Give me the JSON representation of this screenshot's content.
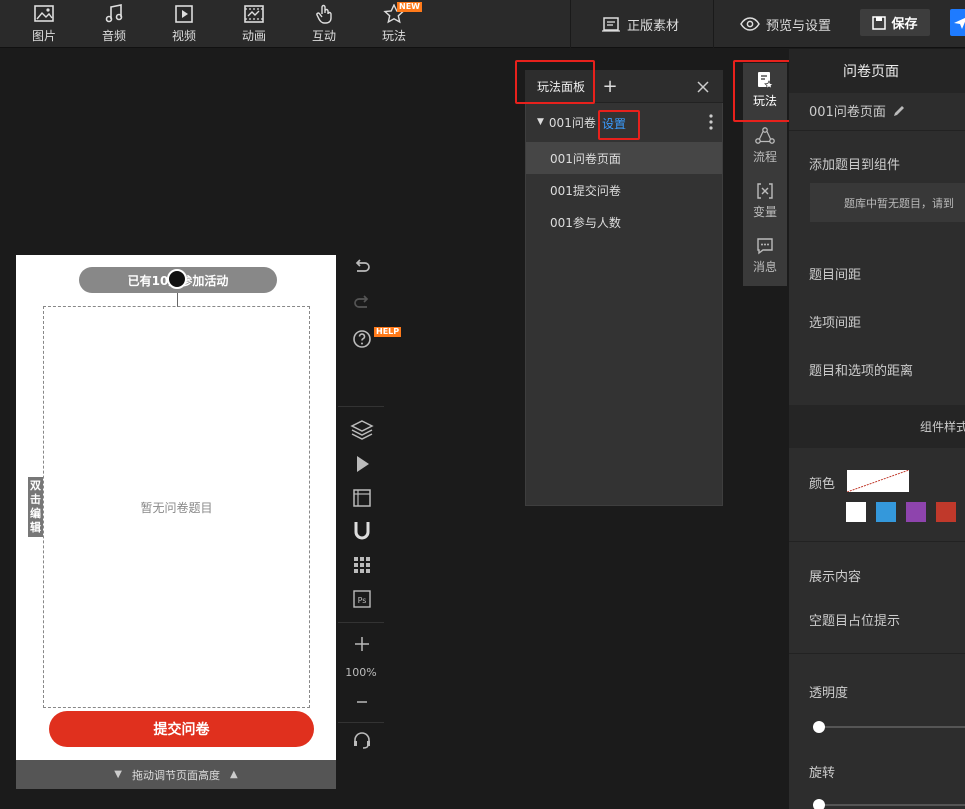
{
  "toolbar": {
    "tools": [
      {
        "label": "图片",
        "icon": "image-icon"
      },
      {
        "label": "音频",
        "icon": "music-icon"
      },
      {
        "label": "视频",
        "icon": "video-icon"
      },
      {
        "label": "动画",
        "icon": "animation-icon"
      },
      {
        "label": "互动",
        "icon": "hand-pointer-icon"
      },
      {
        "label": "玩法",
        "icon": "star-icon",
        "badge": "NEW"
      }
    ],
    "licensed_material": "正版素材",
    "preview_settings": "预览与设置",
    "save": "保存"
  },
  "canvas": {
    "participants_pill": "已有10人参加活动",
    "empty_survey": "暂无问卷题目",
    "double_click_edit": "双击编辑",
    "submit_button": "提交问卷",
    "resize_hint": "拖动调节页面高度",
    "zoom": "100%",
    "help_badge": "HELP"
  },
  "play_panel": {
    "title": "玩法面板",
    "tree_node": "001问卷",
    "tree_setting": "设置",
    "items": [
      "001问卷页面",
      "001提交问卷",
      "001参与人数"
    ],
    "active_index": 0
  },
  "side_tabs": [
    {
      "label": "玩法",
      "icon": "play-doc-icon",
      "active": true
    },
    {
      "label": "流程",
      "icon": "flow-icon"
    },
    {
      "label": "变量",
      "icon": "variable-icon"
    },
    {
      "label": "消息",
      "icon": "message-icon"
    }
  ],
  "properties": {
    "header": "问卷页面",
    "name": "001问卷页面",
    "add_question": "添加题目到组件",
    "bank_empty_hint": "题库中暂无题目，请到",
    "question_spacing": "题目间距",
    "option_spacing": "选项间距",
    "question_option_distance": "题目和选项的距离",
    "component_style": "组件样式",
    "color_label": "颜色",
    "swatch_colors": [
      "#ffffff",
      "#3498db",
      "#8e44ad",
      "#c0392b"
    ],
    "display_content": "展示内容",
    "empty_placeholder": "空题目占位提示",
    "opacity": "透明度",
    "rotation": "旋转"
  }
}
